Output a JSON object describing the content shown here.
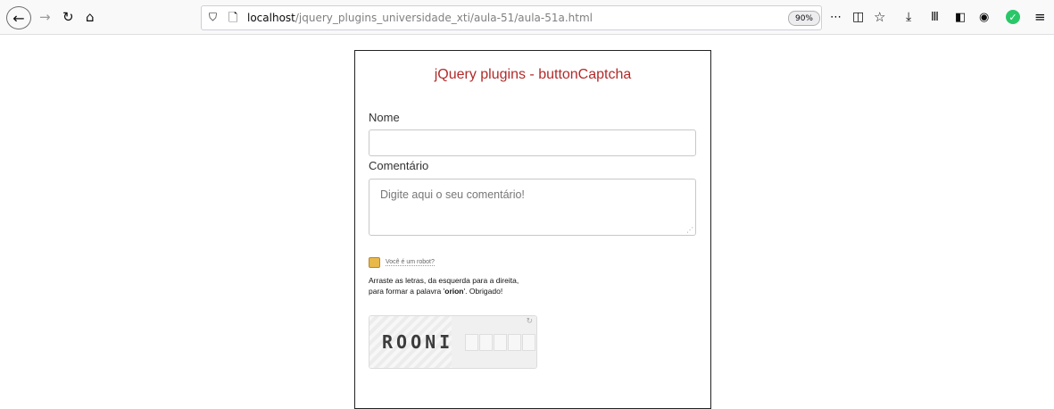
{
  "browser": {
    "url_host": "localhost",
    "url_path": "/jquery_plugins_universidade_xti/aula-51/aula-51a.html",
    "zoom": "90%"
  },
  "page": {
    "title": "jQuery plugins - buttonCaptcha",
    "nome_label": "Nome",
    "nome_value": "",
    "comentario_label": "Comentário",
    "comentario_placeholder": "Digite aqui o seu comentário!",
    "robot_link": "Você é um robot?",
    "instructions_pre": "Arraste as letras, da esquerda para a direita, para formar a palavra '",
    "instructions_word": "orion",
    "instructions_post": "'. Obrigado!",
    "captcha_letters": "ROONI"
  }
}
